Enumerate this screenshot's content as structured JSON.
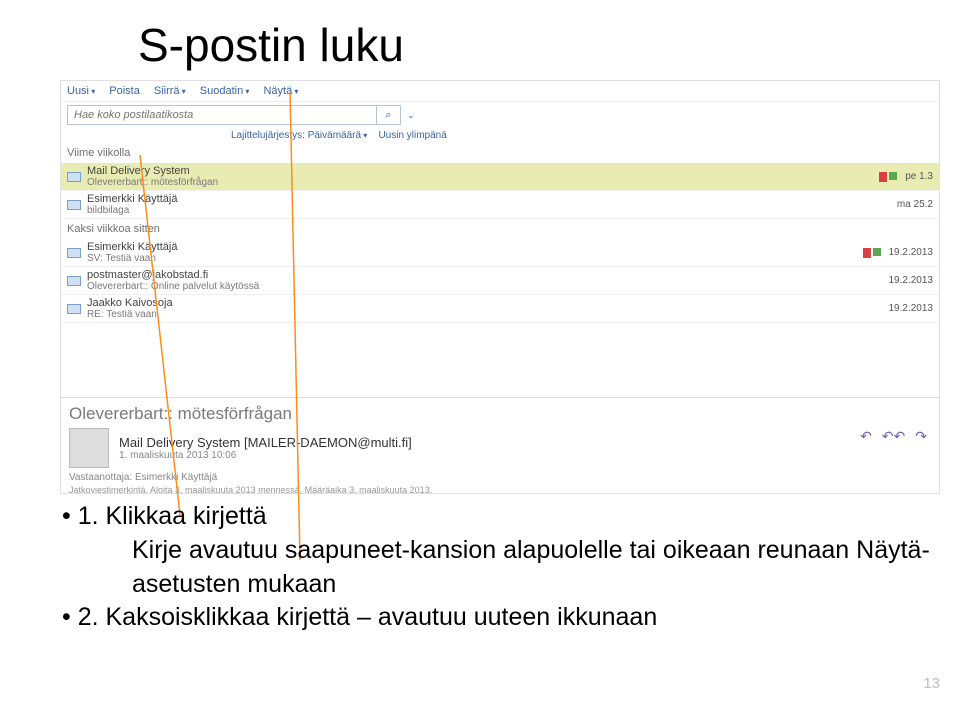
{
  "title": "S-postin luku",
  "toolbar": {
    "new": "Uusi",
    "delete": "Poista",
    "move": "Siirrä",
    "filter": "Suodatin",
    "view": "Näytä"
  },
  "search": {
    "placeholder": "Hae koko postilaatikosta"
  },
  "sort": {
    "label": "Lajittelujärjestys:",
    "by": "Päivämäärä",
    "order": "Uusin ylimpänä"
  },
  "groups": [
    {
      "header": "Viime viikolla",
      "messages": [
        {
          "sender": "Mail Delivery System",
          "subject": "Olevererbart:: mötesförfrågan",
          "date": "pe 1.3",
          "selected": true,
          "flag": true
        },
        {
          "sender": "Esimerkki Käyttäjä",
          "subject": "bildbilaga",
          "date": "ma 25.2"
        }
      ]
    },
    {
      "header": "Kaksi viikkoa sitten",
      "messages": [
        {
          "sender": "Esimerkki Käyttäjä",
          "subject": "SV: Testiä vaan",
          "date": "19.2.2013",
          "flag": true
        },
        {
          "sender": "postmaster@jakobstad.fi",
          "subject": "Olevererbart:: Online palvelut käytössä",
          "date": "19.2.2013"
        },
        {
          "sender": "Jaakko Kaivosoja",
          "subject": "RE: Testiä vaan",
          "date": "19.2.2013"
        }
      ]
    }
  ],
  "preview": {
    "title": "Olevererbart:: mötesförfrågan",
    "from": "Mail Delivery System [MAILER-DAEMON@multi.fi]",
    "time": "1. maaliskuuta 2013 10:06",
    "to_label": "Vastaanottaja:",
    "to": "Esimerkki Käyttäjä",
    "attach": "Jatkoviestimerkintä. Aloita 3. maaliskuuta 2013 mennessä. Määräaika 3. maaliskuuta 2013."
  },
  "bullets": {
    "b1_prefix": "• 1. ",
    "b1": "Klikkaa kirjettä",
    "b1a": "Kirje avautuu saapuneet-kansion alapuolelle tai oikeaan reunaan Näytä-asetusten mukaan",
    "b2_prefix": "• 2. ",
    "b2": "Kaksoisklikkaa kirjettä – avautuu uuteen ikkunaan"
  },
  "page": "13"
}
